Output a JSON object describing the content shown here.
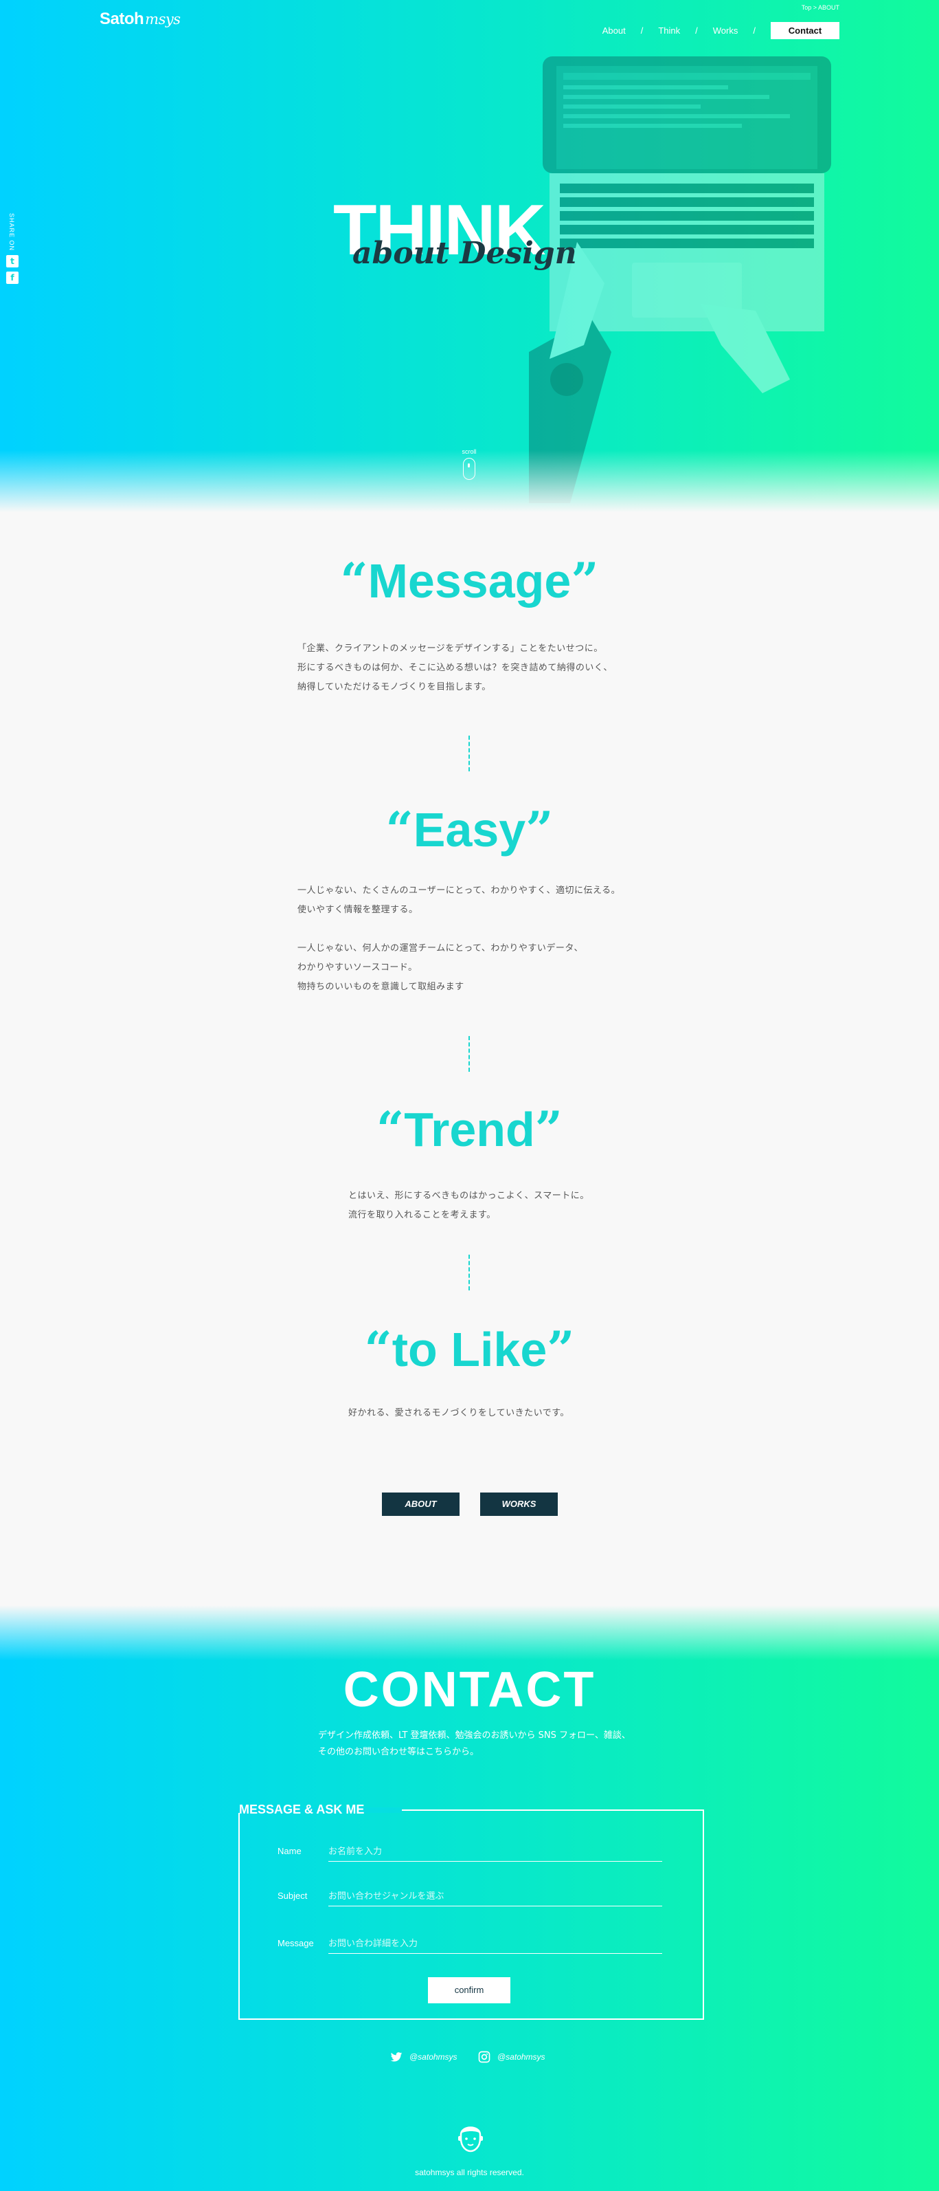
{
  "header": {
    "logo_main": "Satoh",
    "logo_script": "msys",
    "breadcrumb": "Top > ABOUT",
    "nav": [
      {
        "label": "About",
        "sep": "/"
      },
      {
        "label": "Think",
        "sep": "/"
      },
      {
        "label": "Works",
        "sep": "/"
      }
    ],
    "contact_label": "Contact"
  },
  "share": {
    "label": "SHARE ON",
    "icons": [
      "twitter-icon",
      "facebook-icon"
    ]
  },
  "hero": {
    "title_big": "THINK",
    "title_script": "about Design",
    "scroll_label": "scroll"
  },
  "sections": [
    {
      "open_quote": "“",
      "title": "Message",
      "close_quote": "”",
      "paragraphs": [
        [
          "「企業、クライアントのメッセージをデザインする」ことをたいせつに。",
          "形にするべきものは何か、そこに込める想いは？を突き詰めて納得のいく、",
          "納得していただけるモノづくりを目指します。"
        ]
      ]
    },
    {
      "open_quote": "“",
      "title": "Easy",
      "close_quote": "”",
      "paragraphs": [
        [
          "一人じゃない、たくさんのユーザーにとって、わかりやすく、適切に伝える。",
          "使いやすく情報を整理する。"
        ],
        [
          "一人じゃない、何人かの運営チームにとって、わかりやすいデータ、",
          "わかりやすいソースコード。",
          "物持ちのいいものを意識して取組みます"
        ]
      ]
    },
    {
      "open_quote": "“",
      "title": "Trend",
      "close_quote": "”",
      "paragraphs": [
        [
          "とはいえ、形にするべきものはかっこよく、スマートに。",
          "流行を取り入れることを考えます。"
        ]
      ]
    },
    {
      "open_quote": "“",
      "title": "to Like",
      "close_quote": "”",
      "paragraphs": [
        [
          "好かれる、愛されるモノづくりをしていきたいです。"
        ]
      ]
    }
  ],
  "buttons": {
    "about": "ABOUT",
    "works": "WORKS"
  },
  "contact": {
    "title": "CONTACT",
    "desc": [
      "デザイン作成依頼、LT 登壇依頼、勉強会のお誘いから SNS フォロー、雑談、",
      "その他のお問い合わせ等はこちらから。"
    ],
    "form_title": "MESSAGE & ASK ME",
    "fields": [
      {
        "label": "Name",
        "placeholder": "お名前を入力"
      },
      {
        "label": "Subject",
        "placeholder": "お問い合わせジャンルを選ぶ"
      },
      {
        "label": "Message",
        "placeholder": "お問い合わ詳細を入力"
      }
    ],
    "confirm_label": "confirm",
    "social": [
      {
        "icon": "twitter-icon",
        "handle": "@satohmsys"
      },
      {
        "icon": "instagram-icon",
        "handle": "@satohmsys"
      }
    ],
    "copyright": "satohmsys all rights reserved."
  },
  "colors": {
    "gradient_start": "#00d2ff",
    "gradient_end": "#12fb9c",
    "accent": "#18d6cf",
    "button_dark": "#133542",
    "page_bg": "#f8f8f8"
  }
}
